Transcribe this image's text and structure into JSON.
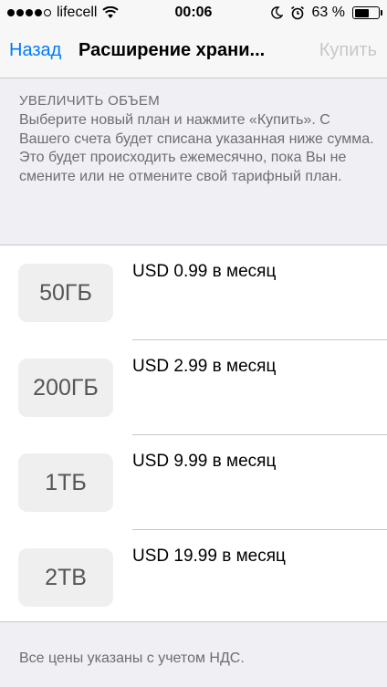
{
  "status": {
    "carrier": "lifecell",
    "time": "00:06",
    "battery": "63 %",
    "battery_level": 0.63
  },
  "nav": {
    "back_label": "Назад",
    "title": "Расширение храни...",
    "buy_label": "Купить"
  },
  "header": {
    "title": "УВЕЛИЧИТЬ ОБЪЕМ",
    "description": "Выберите новый план и нажмите «Купить». С Вашего счета будет списана указанная ниже сумма. Это будет происходить ежемесячно, пока Вы не смените или не отмените свой тарифный план."
  },
  "plans": [
    {
      "size": "50ГБ",
      "price": "USD 0.99 в месяц"
    },
    {
      "size": "200ГБ",
      "price": "USD 2.99 в месяц"
    },
    {
      "size": "1ТБ",
      "price": "USD 9.99 в месяц"
    },
    {
      "size": "2ТВ",
      "price": "USD 19.99 в месяц"
    }
  ],
  "footer": {
    "note": "Все цены указаны с учетом НДС."
  }
}
